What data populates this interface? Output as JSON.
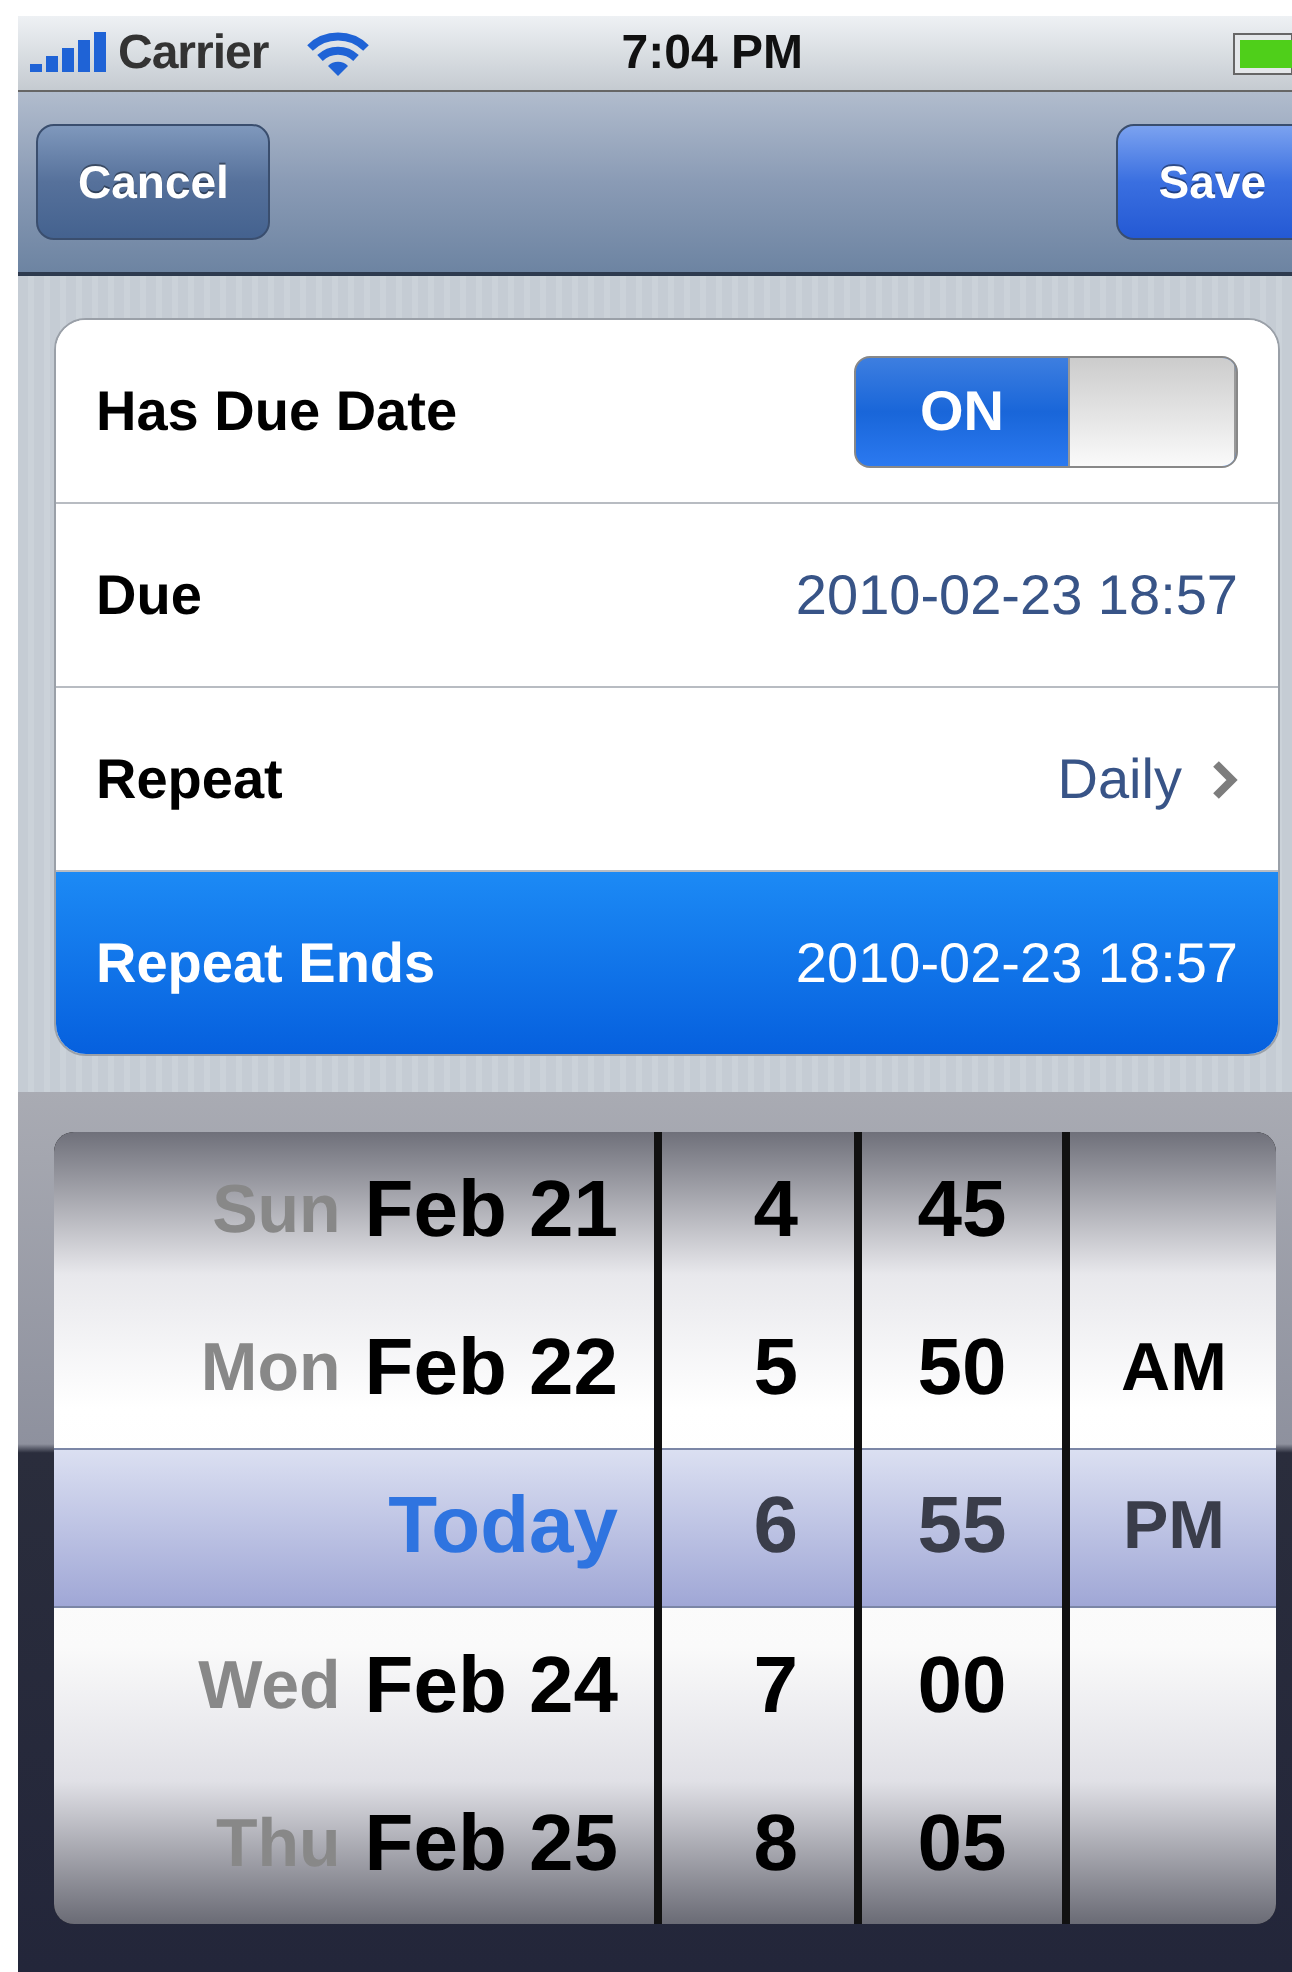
{
  "status_bar": {
    "carrier": "Carrier",
    "time": "7:04 PM"
  },
  "nav_bar": {
    "left_button": "Cancel",
    "right_button": "Save"
  },
  "rows": [
    {
      "kind": "toggle",
      "label": "Has Due Date",
      "on": true,
      "switch_text": "ON",
      "selected": false
    },
    {
      "kind": "value",
      "label": "Due",
      "value": "2010-02-23 18:57",
      "selected": false
    },
    {
      "kind": "disclosure",
      "label": "Repeat",
      "value": "Daily",
      "selected": false
    },
    {
      "kind": "value",
      "label": "Repeat Ends",
      "value": "2010-02-23 18:57",
      "selected": true
    }
  ],
  "picker": {
    "columns": [
      {
        "kind": "date",
        "items": [
          {
            "weekday": "Sun",
            "date": "Feb 21",
            "selected": false
          },
          {
            "weekday": "Mon",
            "date": "Feb 22",
            "selected": false
          },
          {
            "date": "Today",
            "selected": true
          },
          {
            "weekday": "Wed",
            "date": "Feb 24",
            "selected": false
          },
          {
            "weekday": "Thu",
            "date": "Feb 25",
            "selected": false
          }
        ]
      },
      {
        "kind": "hour",
        "items": [
          {
            "value": "4",
            "selected": false
          },
          {
            "value": "5",
            "selected": false
          },
          {
            "value": "6",
            "selected": true
          },
          {
            "value": "7",
            "selected": false
          },
          {
            "value": "8",
            "selected": false
          }
        ]
      },
      {
        "kind": "minute",
        "items": [
          {
            "value": "45",
            "selected": false
          },
          {
            "value": "50",
            "selected": false
          },
          {
            "value": "55",
            "selected": true
          },
          {
            "value": "00",
            "selected": false
          },
          {
            "value": "05",
            "selected": false
          }
        ]
      },
      {
        "kind": "meridiem",
        "items": [
          {
            "value": "AM",
            "selected": false
          },
          {
            "value": "PM",
            "selected": true
          }
        ]
      }
    ]
  }
}
